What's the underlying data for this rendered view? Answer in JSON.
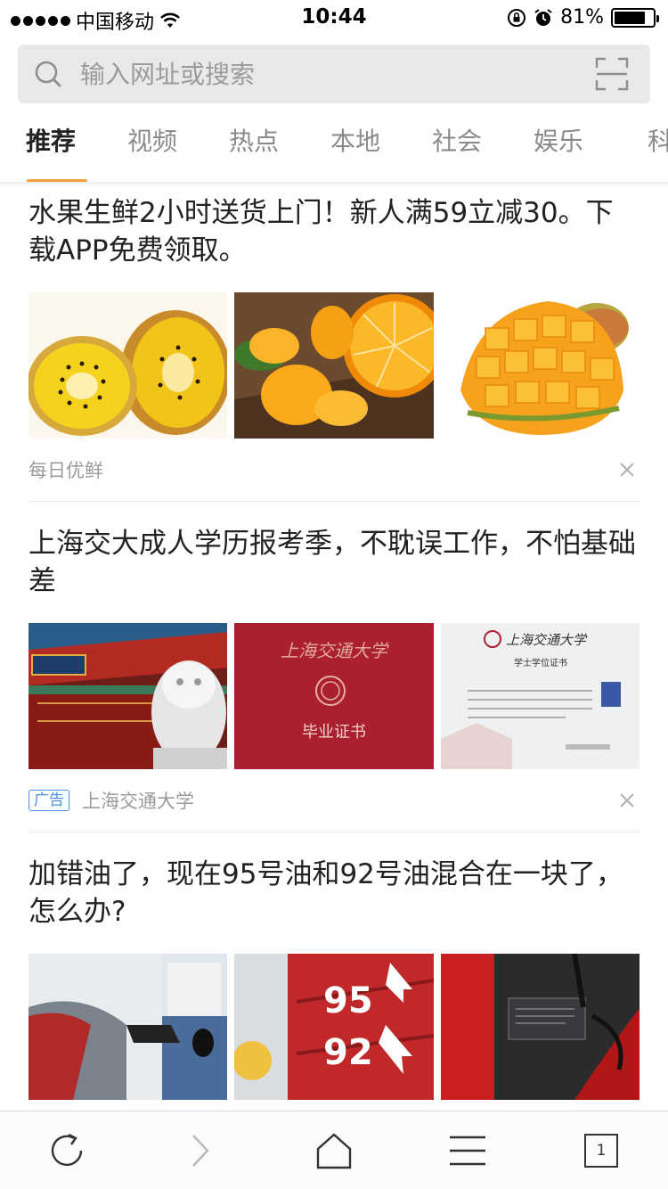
{
  "status_bar": {
    "carrier": "中国移动",
    "time": "10:44",
    "battery_percent": "81%",
    "battery_level": 0.81,
    "icons": [
      "signal-dots-icon",
      "wifi-icon",
      "rotation-lock-icon",
      "alarm-icon",
      "battery-icon"
    ]
  },
  "search": {
    "placeholder": "输入网址或搜索",
    "icon": "search-icon",
    "scan_icon": "scan-icon"
  },
  "tabs": [
    {
      "label": "推荐",
      "active": true
    },
    {
      "label": "视频",
      "active": false
    },
    {
      "label": "热点",
      "active": false
    },
    {
      "label": "本地",
      "active": false
    },
    {
      "label": "社会",
      "active": false
    },
    {
      "label": "娱乐",
      "active": false
    },
    {
      "label": "科",
      "active": false
    }
  ],
  "accent_color": "#f5a142",
  "feed": [
    {
      "title": "水果生鲜2小时送货上门！新人满59立减30。下载APP免费领取。",
      "images": [
        "kiwi-photo",
        "orange-photo",
        "mango-photo"
      ],
      "source": "每日优鲜",
      "ad_label": ""
    },
    {
      "title": "上海交大成人学历报考季，不耽误工作，不怕基础差",
      "images": [
        "university-gate-photo",
        "graduation-certificate-photo",
        "degree-certificate-photo"
      ],
      "source": "上海交通大学",
      "ad_label": "广告",
      "image_text": {
        "cover_title": "上海交通大学",
        "cover_sub": "毕业证书",
        "cert_title": "上海交通大学",
        "cert_sub": "学士学位证书"
      }
    },
    {
      "title": "加错油了，现在95号油和92号油混合在一块了，怎么办?",
      "images": [
        "fuel-nozzle-photo",
        "gas-pump-95-92-photo",
        "fuel-cap-photo"
      ],
      "image_text": {
        "pump_95": "95",
        "pump_92": "92"
      }
    }
  ],
  "bottom_nav": {
    "items": [
      "refresh-icon",
      "forward-icon",
      "home-icon",
      "menu-icon",
      "tabs-icon"
    ],
    "tab_count": "1"
  }
}
